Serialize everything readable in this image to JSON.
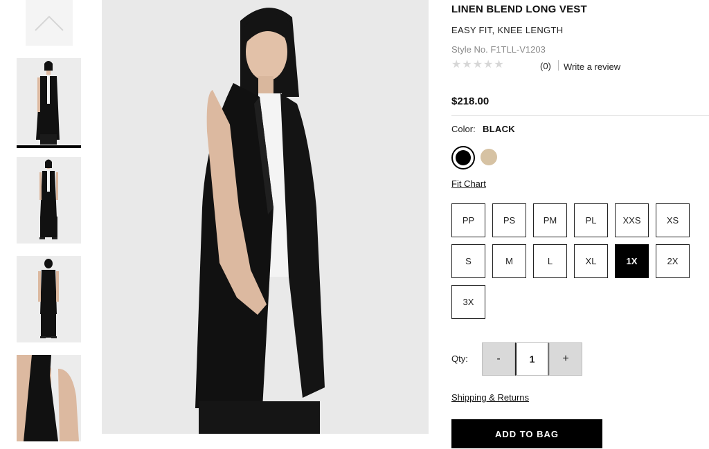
{
  "product": {
    "title": "LINEN BLEND LONG VEST",
    "subtitle": "EASY FIT, KNEE LENGTH",
    "style_number": "Style No. F1TLL-V1203",
    "rating_stars": "★★★★★",
    "review_count": "(0)",
    "write_review_label": "Write a review",
    "price": "$218.00"
  },
  "color": {
    "label": "Color:",
    "selected": "BLACK",
    "swatches": [
      {
        "name": "black",
        "hex": "#000000"
      },
      {
        "name": "tan",
        "hex": "#d6c2a3"
      }
    ]
  },
  "fit_chart_label": "Fit Chart",
  "sizes": [
    "PP",
    "PS",
    "PM",
    "PL",
    "XXS",
    "XS",
    "S",
    "M",
    "L",
    "XL",
    "1X",
    "2X",
    "3X"
  ],
  "selected_size": "1X",
  "quantity": {
    "label": "Qty:",
    "minus": "-",
    "value": "1",
    "plus": "+"
  },
  "shipping_label": "Shipping & Returns",
  "add_to_bag_label": "ADD TO BAG",
  "icons": {
    "scroll_up": "chevron-up-icon"
  }
}
